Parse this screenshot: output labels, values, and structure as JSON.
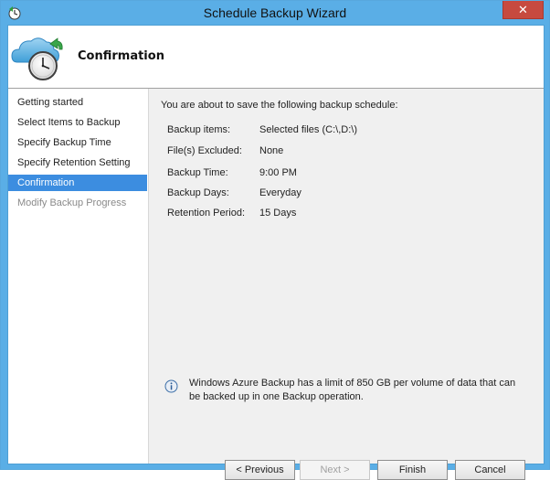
{
  "window": {
    "title": "Schedule Backup Wizard",
    "close_glyph": "✕",
    "app_icon": "backup-app-icon"
  },
  "header": {
    "title": "Confirmation",
    "icon": "cloud-clock-icon"
  },
  "nav": {
    "items": [
      {
        "label": "Getting started",
        "state": "normal"
      },
      {
        "label": "Select Items to Backup",
        "state": "normal"
      },
      {
        "label": "Specify Backup Time",
        "state": "normal"
      },
      {
        "label": "Specify Retention Setting",
        "state": "normal"
      },
      {
        "label": "Confirmation",
        "state": "active"
      },
      {
        "label": "Modify Backup Progress",
        "state": "disabled"
      }
    ]
  },
  "main": {
    "intro": "You are about to save the following backup schedule:",
    "summary": [
      {
        "label": "Backup items:",
        "value": "Selected files (C:\\,D:\\)"
      },
      {
        "label": "File(s) Excluded:",
        "value": "None"
      },
      {
        "label": "Backup Time:",
        "value": "9:00 PM"
      },
      {
        "label": "Backup Days:",
        "value": "Everyday"
      },
      {
        "label": "Retention Period:",
        "value": "15 Days"
      }
    ],
    "info_text": "Windows Azure Backup has a limit of 850 GB per volume of data that can be backed up in one Backup operation."
  },
  "buttons": {
    "previous": "< Previous",
    "next": "Next >",
    "finish": "Finish",
    "cancel": "Cancel"
  },
  "colors": {
    "titlebar": "#5aaee6",
    "accent": "#3c8de0",
    "close": "#c74a3f"
  }
}
